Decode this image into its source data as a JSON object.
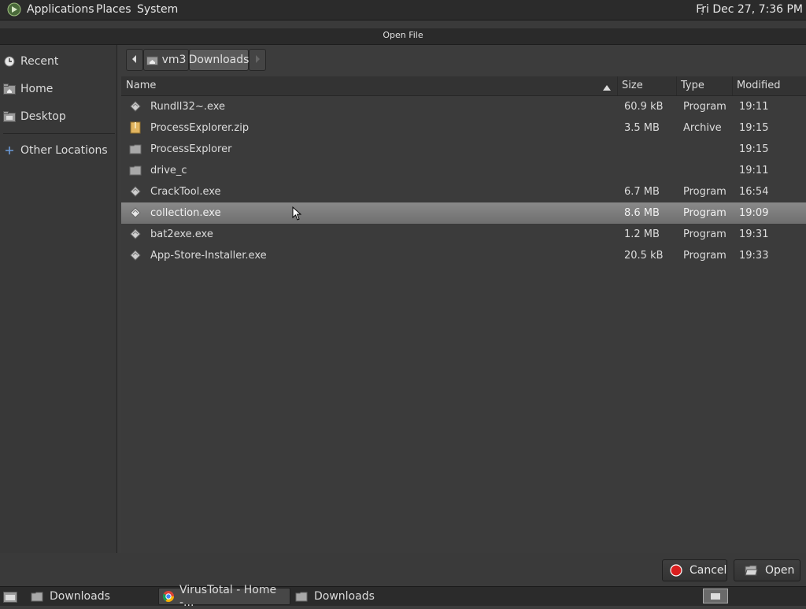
{
  "top_panel": {
    "menus": [
      "Applications",
      "Places",
      "System"
    ],
    "clock": "Fri Dec 27,  7:36 PM"
  },
  "window": {
    "title": "Open File"
  },
  "sidebar": {
    "items": [
      {
        "label": "Recent",
        "icon": "clock-icon"
      },
      {
        "label": "Home",
        "icon": "home-folder-icon"
      },
      {
        "label": "Desktop",
        "icon": "desktop-folder-icon"
      },
      {
        "label": "Other Locations",
        "icon": "plus-icon"
      }
    ]
  },
  "pathbar": {
    "segments": [
      "vm3",
      "Downloads"
    ]
  },
  "columns": {
    "name": "Name",
    "size": "Size",
    "type": "Type",
    "modified": "Modified"
  },
  "files": [
    {
      "name": "Rundll32~.exe",
      "size": "60.9 kB",
      "type": "Program",
      "modified": "19:11",
      "icon": "executable-icon"
    },
    {
      "name": "ProcessExplorer.zip",
      "size": "3.5 MB",
      "type": "Archive",
      "modified": "19:15",
      "icon": "archive-icon"
    },
    {
      "name": "ProcessExplorer",
      "size": "",
      "type": "",
      "modified": "19:15",
      "icon": "folder-icon"
    },
    {
      "name": "drive_c",
      "size": "",
      "type": "",
      "modified": "19:11",
      "icon": "folder-icon"
    },
    {
      "name": "CrackTool.exe",
      "size": "6.7 MB",
      "type": "Program",
      "modified": "16:54",
      "icon": "executable-icon"
    },
    {
      "name": "collection.exe",
      "size": "8.6 MB",
      "type": "Program",
      "modified": "19:09",
      "icon": "executable-icon",
      "selected": true
    },
    {
      "name": "bat2exe.exe",
      "size": "1.2 MB",
      "type": "Program",
      "modified": "19:31",
      "icon": "executable-icon"
    },
    {
      "name": "App-Store-Installer.exe",
      "size": "20.5 kB",
      "type": "Program",
      "modified": "19:33",
      "icon": "executable-icon"
    }
  ],
  "buttons": {
    "cancel": "Cancel",
    "open": "Open"
  },
  "taskbar": {
    "tasks": [
      {
        "label": "Downloads",
        "icon": "folder-icon"
      },
      {
        "label": "VirusTotal - Home -...",
        "icon": "chrome-icon",
        "active": true
      },
      {
        "label": "Downloads",
        "icon": "folder-icon"
      }
    ]
  },
  "colors": {
    "selected_row": "#7d7d7d",
    "background": "#3b3b3b",
    "panel": "#2b2b2b"
  }
}
